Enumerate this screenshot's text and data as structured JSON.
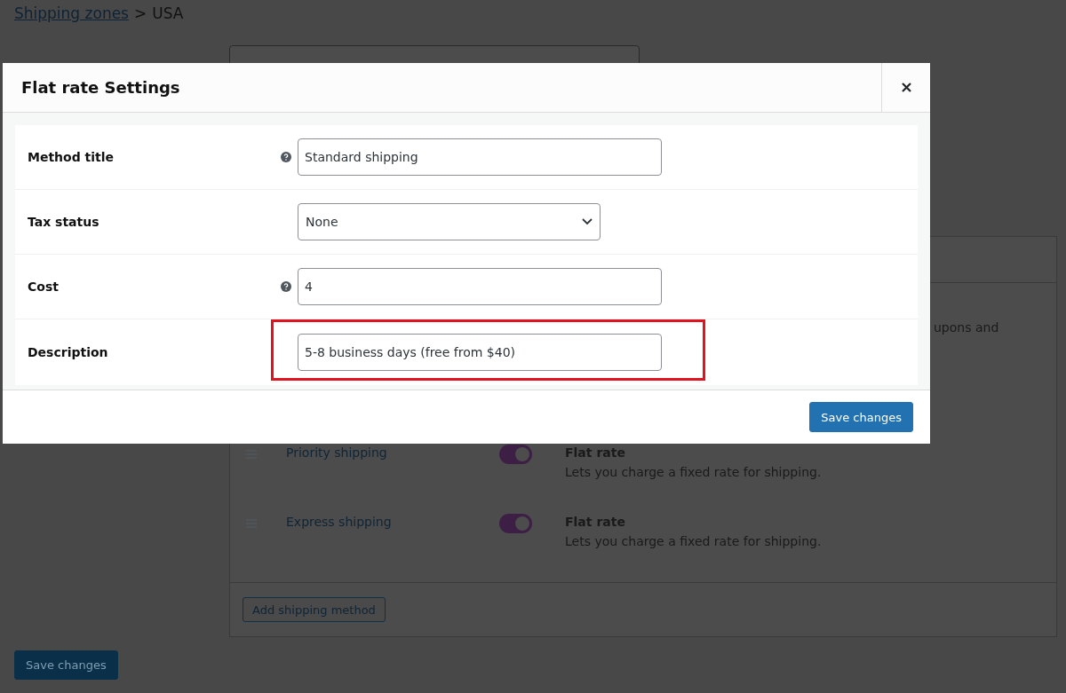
{
  "breadcrumb": {
    "link": "Shipping zones",
    "separator": ">",
    "current": "USA"
  },
  "methods_panel": {
    "partial_description": "upons and",
    "methods": [
      {
        "title": "Priority shipping",
        "enabled": true,
        "type": "Flat rate",
        "description": "Lets you charge a fixed rate for shipping."
      },
      {
        "title": "Express shipping",
        "enabled": true,
        "type": "Flat rate",
        "description": "Lets you charge a fixed rate for shipping."
      }
    ],
    "add_button": "Add shipping method"
  },
  "save_button": "Save changes",
  "modal": {
    "title": "Flat rate Settings",
    "fields": [
      {
        "label": "Method title",
        "kind": "text",
        "help": true,
        "value": "Standard shipping",
        "highlighted": false
      },
      {
        "label": "Tax status",
        "kind": "select",
        "help": false,
        "value": "None",
        "highlighted": false
      },
      {
        "label": "Cost",
        "kind": "text",
        "help": true,
        "value": "4",
        "highlighted": false
      },
      {
        "label": "Description",
        "kind": "text",
        "help": false,
        "value": "5-8 business days (free from $40)",
        "highlighted": true
      }
    ],
    "save_button": "Save changes"
  }
}
